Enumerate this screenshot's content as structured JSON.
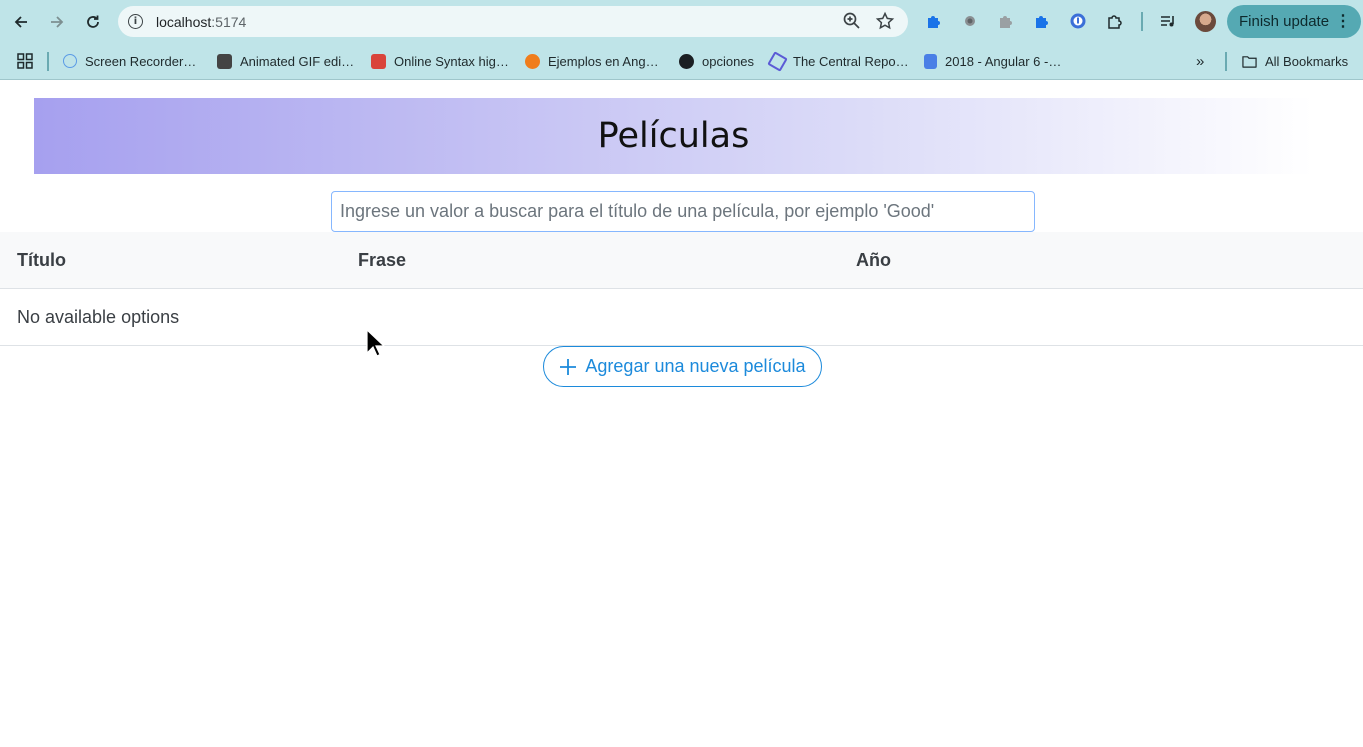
{
  "browser": {
    "url_host": "localhost",
    "url_port": ":5174",
    "finish_update_label": "Finish update",
    "bookmarks": [
      {
        "label": "Screen Recorder…",
        "icon": "screen-recorder-icon",
        "color": "#5b9be6"
      },
      {
        "label": "Animated GIF edi…",
        "icon": "gif-editor-icon",
        "color": "#444444"
      },
      {
        "label": "Online Syntax hig…",
        "icon": "syntax-highlighter-icon",
        "color": "#d9443b"
      },
      {
        "label": "Ejemplos en Ang…",
        "icon": "ejemplos-icon",
        "color": "#f07d1c"
      },
      {
        "label": "opciones",
        "icon": "github-icon",
        "color": "#1b1f23"
      },
      {
        "label": "The Central Repo…",
        "icon": "central-repo-icon",
        "color": "#5b5bd6"
      },
      {
        "label": "2018 - Angular 6 -…",
        "icon": "google-docs-icon",
        "color": "#4a7fe6"
      }
    ],
    "all_bookmarks_label": "All Bookmarks"
  },
  "page": {
    "title": "Películas",
    "search_placeholder": "Ingrese un valor a buscar para el título de una película, por ejemplo 'Good'",
    "search_value": "",
    "table": {
      "columns": [
        "Título",
        "Frase",
        "Año"
      ],
      "empty_message": "No available options"
    },
    "add_button_label": "Agregar una nueva película"
  },
  "colors": {
    "accent": "#1c8adb",
    "chrome_bg": "#bfe4e8",
    "hero_gradient_start": "#a6a0ef"
  }
}
